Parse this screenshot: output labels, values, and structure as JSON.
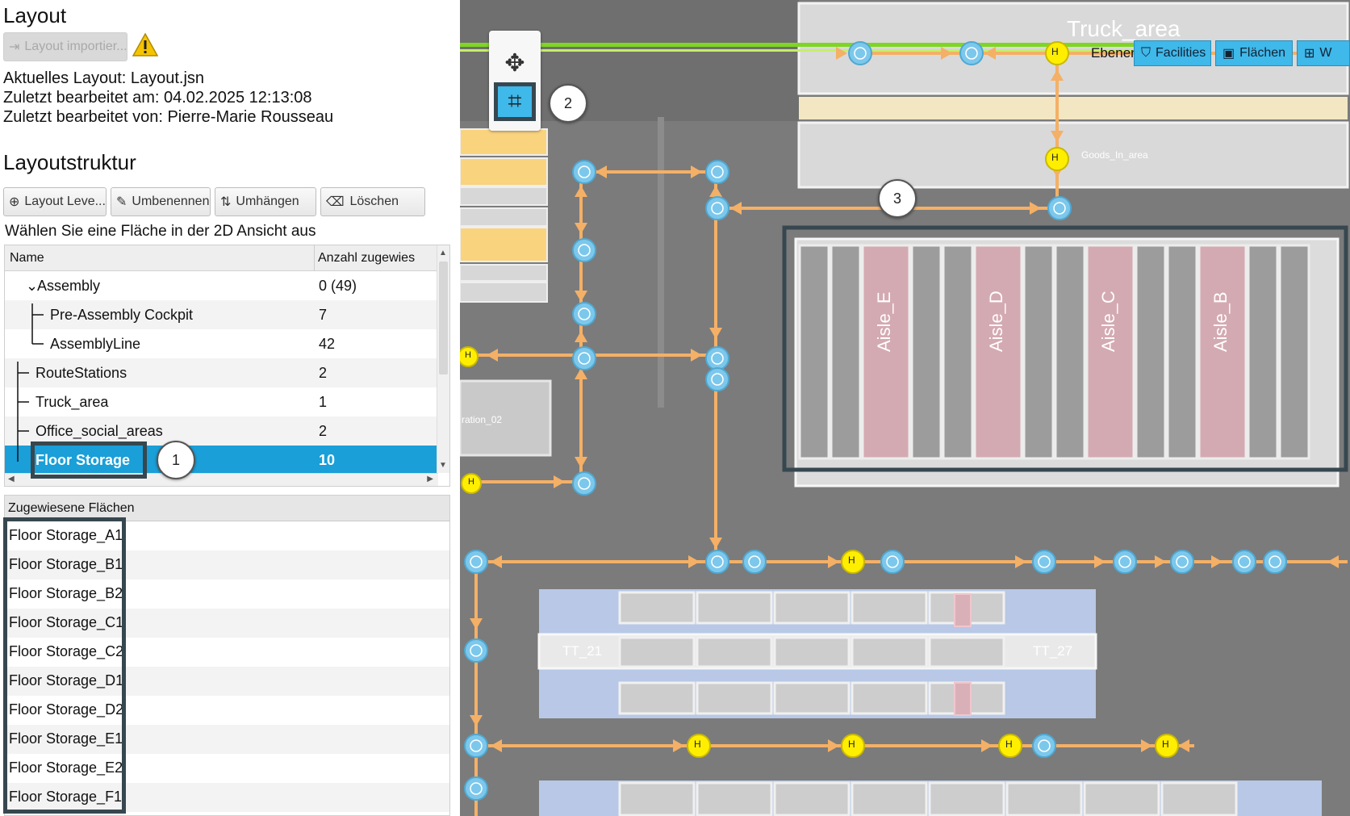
{
  "layout": {
    "title": "Layout",
    "import_button": "Layout importier...",
    "current_layout": "Aktuelles Layout: Layout.jsn",
    "edited_at": "Zuletzt bearbeitet am: 04.02.2025 12:13:08",
    "edited_by": "Zuletzt bearbeitet von: Pierre-Marie Rousseau"
  },
  "structure": {
    "title": "Layoutstruktur",
    "buttons": {
      "level": "Layout Leve...",
      "rename": "Umbenennen",
      "reassign": "Umhängen",
      "delete": "Löschen"
    },
    "hint": "Wählen Sie eine Fläche in der 2D Ansicht aus",
    "columns": {
      "name": "Name",
      "count": "Anzahl zugewies."
    },
    "rows": [
      {
        "name": "Assembly",
        "count": "0 (49)"
      },
      {
        "name": "Pre-Assembly Cockpit",
        "count": "7"
      },
      {
        "name": "AssemblyLine",
        "count": "42"
      },
      {
        "name": "RouteStations",
        "count": "2"
      },
      {
        "name": "Truck_area",
        "count": "1"
      },
      {
        "name": "Office_social_areas",
        "count": "2"
      },
      {
        "name": "Floor Storage",
        "count": "10"
      }
    ]
  },
  "assigned": {
    "header": "Zugewiesene Flächen",
    "items": [
      "Floor Storage_A1",
      "Floor Storage_B1",
      "Floor Storage_B2",
      "Floor Storage_C1",
      "Floor Storage_C2",
      "Floor Storage_D1",
      "Floor Storage_D2",
      "Floor Storage_E1",
      "Floor Storage_E2",
      "Floor Storage_F1"
    ]
  },
  "callouts": [
    "1",
    "2",
    "3"
  ],
  "map": {
    "truck_area": "Truck_area",
    "ebenen": "Ebenen",
    "tabs": [
      "Facilities",
      "Flächen",
      "W"
    ],
    "goods_in": "Goods_In_area",
    "station_label": "ration_02",
    "aisles": [
      "Aisle_E",
      "Aisle_D",
      "Aisle_C",
      "Aisle_B"
    ],
    "tt_left": "TT_21",
    "tt_right": "TT_27",
    "node_h": "H"
  },
  "colors": {
    "accent": "#1a9fd8",
    "path": "#f4b066",
    "node_blue": "#7cc8ec",
    "node_yellow": "#ffee00",
    "aisle": "#d4aab2"
  }
}
